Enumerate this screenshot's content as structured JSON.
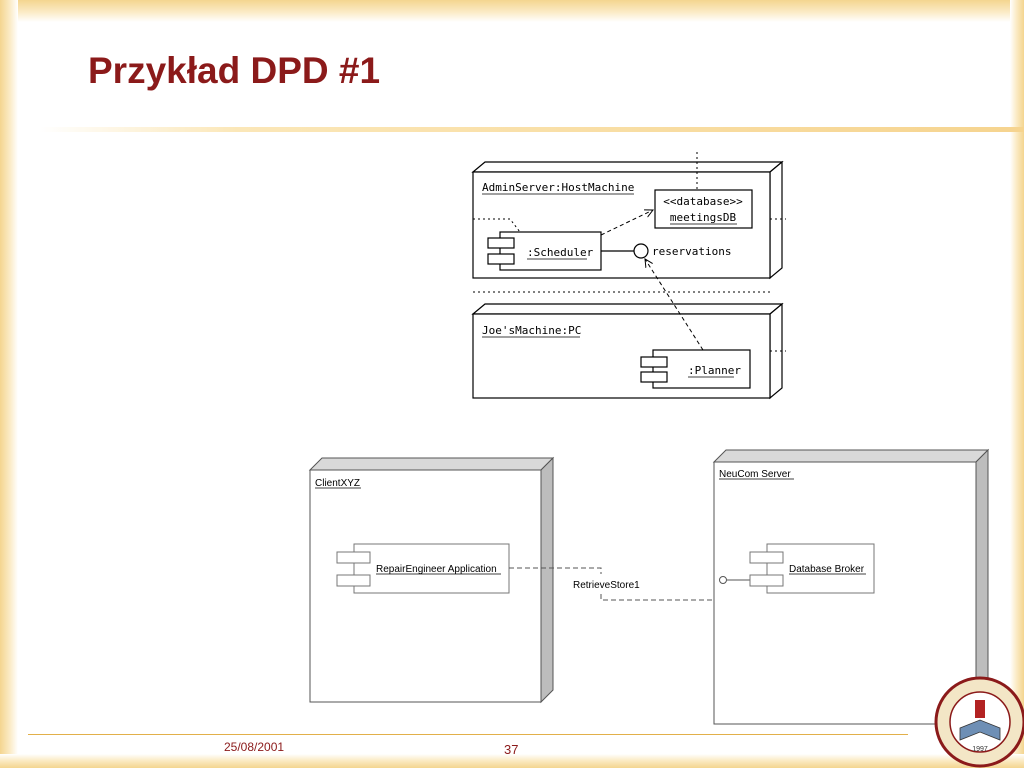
{
  "slide": {
    "title": "Przykład DPD #1",
    "footer_date": "25/08/2001",
    "page_number": "37"
  },
  "diagram_top": {
    "node_admin": "AdminServer:HostMachine",
    "database_stereotype": "<<database>>",
    "database_name": "meetingsDB",
    "scheduler": ":Scheduler",
    "interface": "reservations",
    "node_joe": "Joe'sMachine:PC",
    "planner": ":Planner"
  },
  "diagram_bottom": {
    "node_client": "ClientXYZ",
    "component_repair": "RepairEngineer Application",
    "interface": "RetrieveStore1",
    "node_server": "NeuCom Server",
    "component_broker": "Database Broker"
  },
  "logo": {
    "year": "1997"
  },
  "colors": {
    "title": "#8b1a1a",
    "frame": "#f4d58f",
    "node_side": "#bdbdbd"
  }
}
